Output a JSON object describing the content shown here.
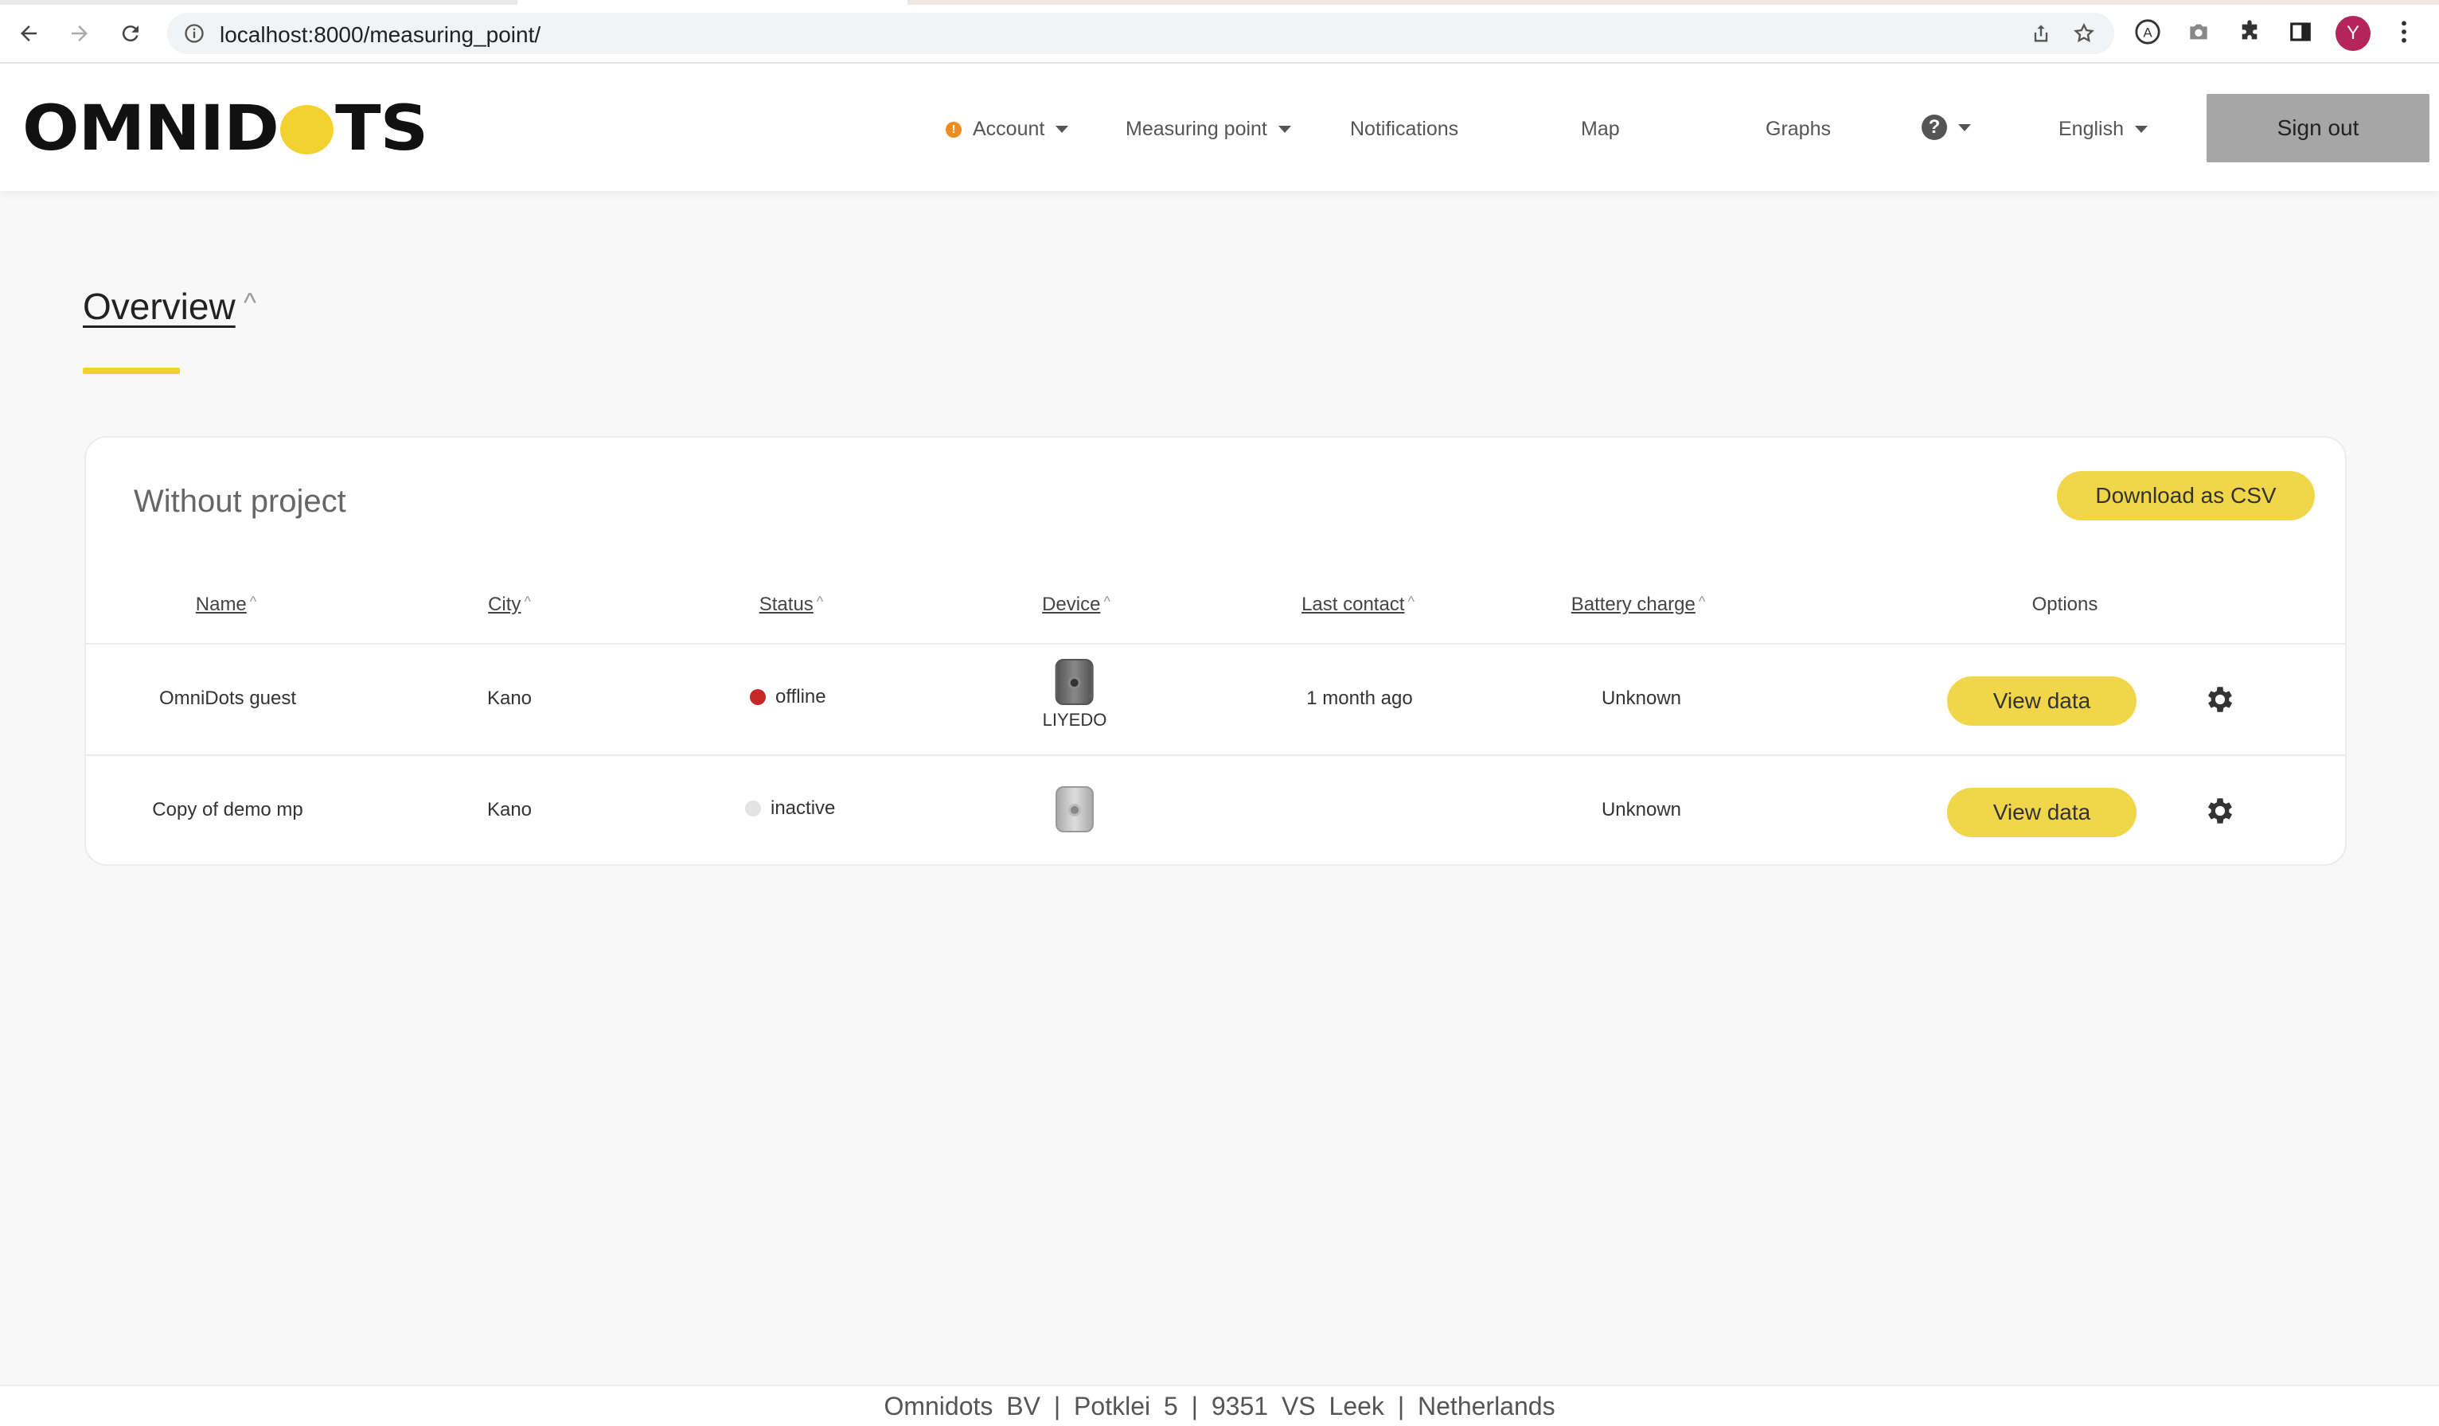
{
  "browser": {
    "url": "localhost:8000/measuring_point/",
    "avatar_initial": "Y"
  },
  "header": {
    "logo_text_1": "OMNID",
    "logo_text_2": "TS",
    "nav": {
      "account": "Account",
      "measuring_point": "Measuring point",
      "notifications": "Notifications",
      "map": "Map",
      "graphs": "Graphs",
      "help": "?",
      "language": "English"
    },
    "account_alert": "!",
    "sign_out": "Sign out"
  },
  "page": {
    "title": "Overview",
    "title_sort": "^"
  },
  "card": {
    "title": "Without project",
    "download_csv": "Download as CSV",
    "columns": {
      "name": "Name",
      "city": "City",
      "status": "Status",
      "device": "Device",
      "last_contact": "Last contact",
      "battery": "Battery charge",
      "options": "Options"
    },
    "sort_arrow": "^",
    "rows": [
      {
        "name": "OmniDots guest",
        "city": "Kano",
        "status": "offline",
        "status_color": "#c62828",
        "device_label": "LIYEDO",
        "last_contact": "1 month ago",
        "battery": "Unknown",
        "view": "View data"
      },
      {
        "name": "Copy of demo mp",
        "city": "Kano",
        "status": "inactive",
        "status_color": "#e3e3e3",
        "device_label": "",
        "last_contact": "",
        "battery": "Unknown",
        "view": "View data"
      }
    ]
  },
  "footer": {
    "text": "Omnidots BV | Potklei 5 | 9351 VS Leek | Netherlands"
  },
  "colors": {
    "accent": "#f2d64a",
    "sign_out_bg": "#a6a6a6"
  }
}
